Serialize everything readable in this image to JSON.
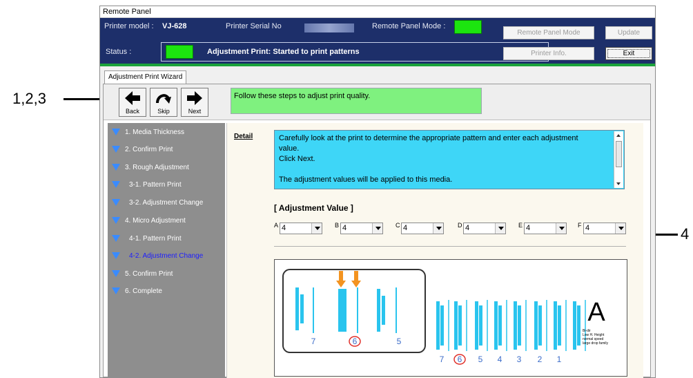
{
  "callouts": {
    "left": "1,2,3",
    "right": "4"
  },
  "window": {
    "title": "Remote Panel",
    "printer_model_label": "Printer model :",
    "printer_model": "VJ-628",
    "serial_label": "Printer Serial No",
    "panel_mode_label": "Remote Panel Mode :",
    "status_label": "Status :",
    "status_text": "Adjustment Print: Started to print patterns",
    "buttons": {
      "remote_panel_mode": "Remote Panel Mode",
      "update": "Update",
      "printer_info": "Printer Info.",
      "exit": "Exit"
    }
  },
  "tab": {
    "label": "Adjustment Print Wizard"
  },
  "toolbar": {
    "back": "Back",
    "skip": "Skip",
    "next": "Next",
    "guide": "Follow these steps to adjust print quality."
  },
  "steps": [
    {
      "label": "1. Media Thickness",
      "active": false
    },
    {
      "label": "2. Confirm Print",
      "active": false
    },
    {
      "label": "3. Rough Adjustment",
      "active": false
    },
    {
      "label": "3-1.  Pattern Print",
      "active": false
    },
    {
      "label": "3-2.  Adjustment Change",
      "active": false
    },
    {
      "label": "4. Micro Adjustment",
      "active": false
    },
    {
      "label": "4-1.  Pattern Print",
      "active": false
    },
    {
      "label": "4-2.  Adjustment Change",
      "active": true
    },
    {
      "label": "5. Confirm Print",
      "active": false
    },
    {
      "label": "6. Complete",
      "active": false
    }
  ],
  "detail": {
    "label": "Detail",
    "line1": "Carefully look at the print to determine the appropriate pattern and enter each adjustment",
    "line2": "value.",
    "line3": "Click Next.",
    "line4": "The adjustment values will be applied to this media."
  },
  "adjustment": {
    "title": "[ Adjustment Value ]",
    "fields": [
      {
        "letter": "A",
        "value": "4"
      },
      {
        "letter": "B",
        "value": "4"
      },
      {
        "letter": "C",
        "value": "4"
      },
      {
        "letter": "D",
        "value": "4"
      },
      {
        "letter": "E",
        "value": "4"
      },
      {
        "letter": "F",
        "value": "4"
      }
    ]
  },
  "pattern": {
    "zoom_numbers": [
      "7",
      "6",
      "5"
    ],
    "row_numbers": [
      "7",
      "6",
      "5",
      "4",
      "3",
      "2",
      "1"
    ],
    "big_letter": "A",
    "notes": [
      "Bi-dir",
      "Low H. Height",
      "normal speed",
      "large drop family"
    ],
    "colors": {
      "bar": "#29c4ee",
      "arrow": "#f39320",
      "circle": "#e0302a",
      "number": "#3b6cc9"
    }
  }
}
